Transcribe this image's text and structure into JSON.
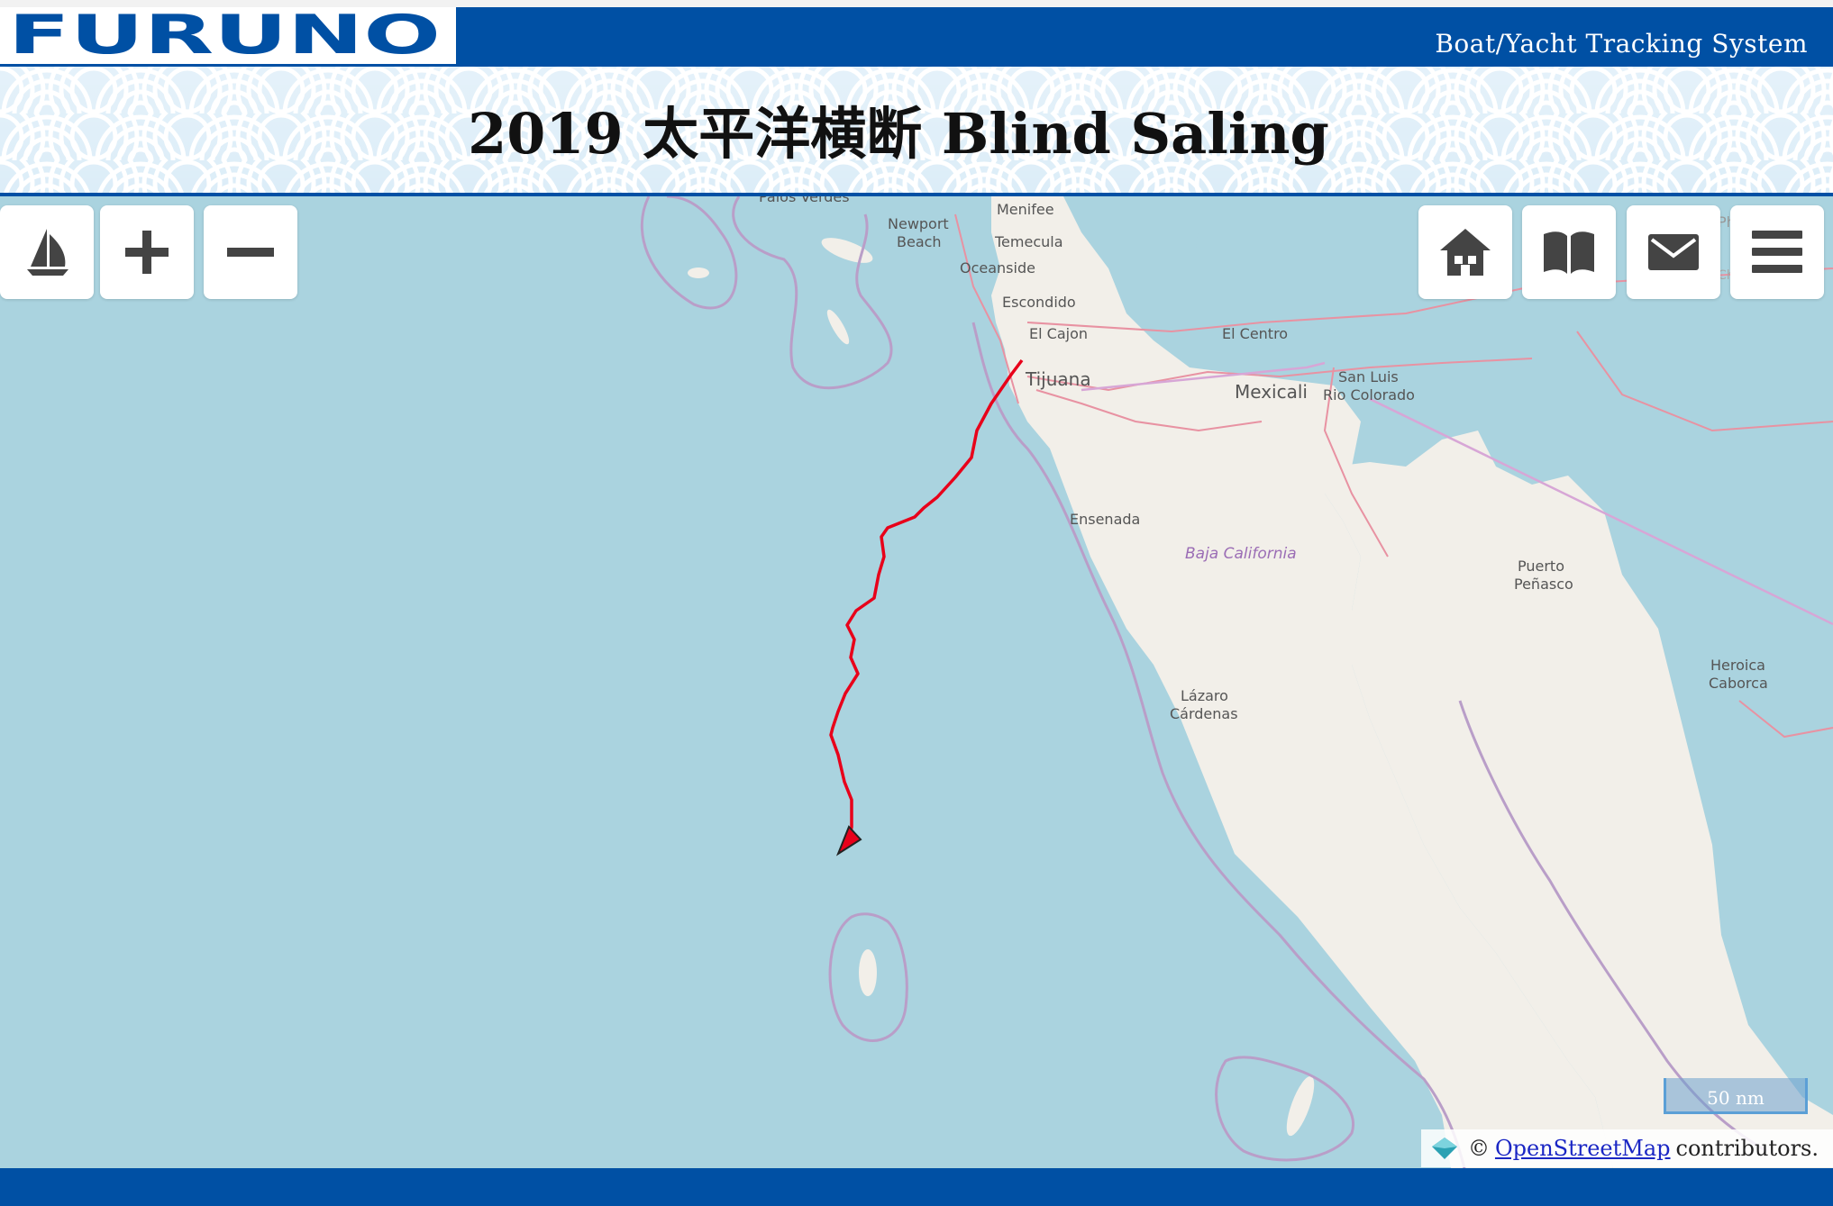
{
  "header": {
    "logo_text": "FURUNO",
    "tagline": "Boat/Yacht Tracking System",
    "colors": {
      "brand": "#0050a4",
      "background": "#ffffff"
    }
  },
  "title": "2019 太平洋横断 Blind Saling",
  "map_controls": {
    "left": [
      {
        "name": "boat-button",
        "icon": "sailboat-icon"
      },
      {
        "name": "zoom-in-button",
        "icon": "plus-icon"
      },
      {
        "name": "zoom-out-button",
        "icon": "minus-icon"
      }
    ],
    "right": [
      {
        "name": "home-button",
        "icon": "home-icon"
      },
      {
        "name": "logbook-button",
        "icon": "book-icon"
      },
      {
        "name": "mail-button",
        "icon": "mail-icon"
      },
      {
        "name": "menu-button",
        "icon": "hamburger-icon"
      }
    ]
  },
  "map": {
    "colors": {
      "water": "#aad3df",
      "land": "#f2efe9",
      "track": "#e8001a",
      "boundary": "#b99ec8"
    },
    "places": {
      "palos_verdes": "Palos Verdes",
      "newport": "Newport",
      "beach": "Beach",
      "menifee": "Menifee",
      "temecula": "Temecula",
      "oceanside": "Oceanside",
      "escondido": "Escondido",
      "el_cajon": "El Cajon",
      "el_centro": "El Centro",
      "tijuana": "Tijuana",
      "mexicali": "Mexicali",
      "san_luis": "San Luis",
      "rio_colorado": "Rio Colorado",
      "ensenada": "Ensenada",
      "baja_california": "Baja California",
      "puerto": "Puerto",
      "penasco": "Peñasco",
      "heroica": "Heroica",
      "caborca": "Caborca",
      "lazaro": "Lázaro",
      "cardenas": "Cárdenas",
      "phoenix": "Phoenix",
      "chandler": "Chandler"
    },
    "scale_label": "50 nm",
    "attribution": {
      "prefix": "©",
      "link": "OpenStreetMap",
      "suffix": "contributors."
    }
  }
}
